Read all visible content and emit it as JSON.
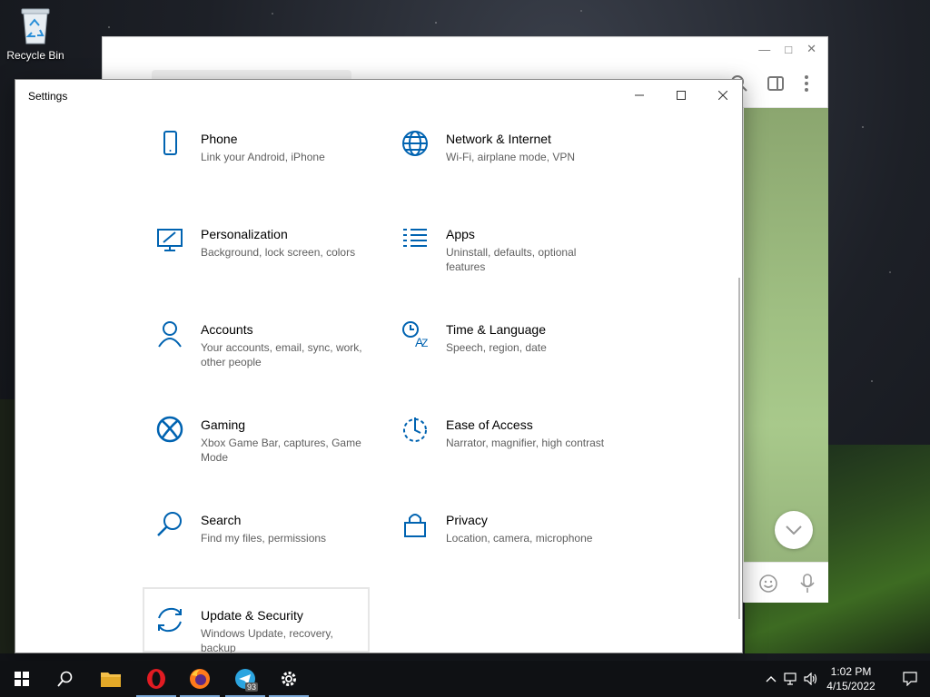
{
  "desktop": {
    "recycle_bin_label": "Recycle Bin"
  },
  "settings_window": {
    "title": "Settings",
    "tiles": [
      {
        "icon": "phone-icon",
        "name": "Phone",
        "desc": "Link your Android, iPhone"
      },
      {
        "icon": "globe-icon",
        "name": "Network & Internet",
        "desc": "Wi-Fi, airplane mode, VPN"
      },
      {
        "icon": "personalization-icon",
        "name": "Personalization",
        "desc": "Background, lock screen, colors"
      },
      {
        "icon": "apps-list-icon",
        "name": "Apps",
        "desc": "Uninstall, defaults, optional features"
      },
      {
        "icon": "person-icon",
        "name": "Accounts",
        "desc": "Your accounts, email, sync, work, other people"
      },
      {
        "icon": "time-language-icon",
        "name": "Time & Language",
        "desc": "Speech, region, date"
      },
      {
        "icon": "xbox-icon",
        "name": "Gaming",
        "desc": "Xbox Game Bar, captures, Game Mode"
      },
      {
        "icon": "ease-of-access-icon",
        "name": "Ease of Access",
        "desc": "Narrator, magnifier, high contrast"
      },
      {
        "icon": "search-icon",
        "name": "Search",
        "desc": "Find my files, permissions"
      },
      {
        "icon": "lock-icon",
        "name": "Privacy",
        "desc": "Location, camera, microphone"
      },
      {
        "icon": "sync-icon",
        "name": "Update & Security",
        "desc": "Windows Update, recovery, backup"
      }
    ],
    "accent_color": "#0063b1"
  },
  "taskbar": {
    "apps": [
      "start-icon",
      "search-icon",
      "file-explorer-icon",
      "opera-icon",
      "firefox-icon",
      "telegram-icon",
      "settings-gear-icon"
    ],
    "telegram_badge": "93",
    "clock_time": "1:02 PM",
    "clock_date": "4/15/2022"
  }
}
